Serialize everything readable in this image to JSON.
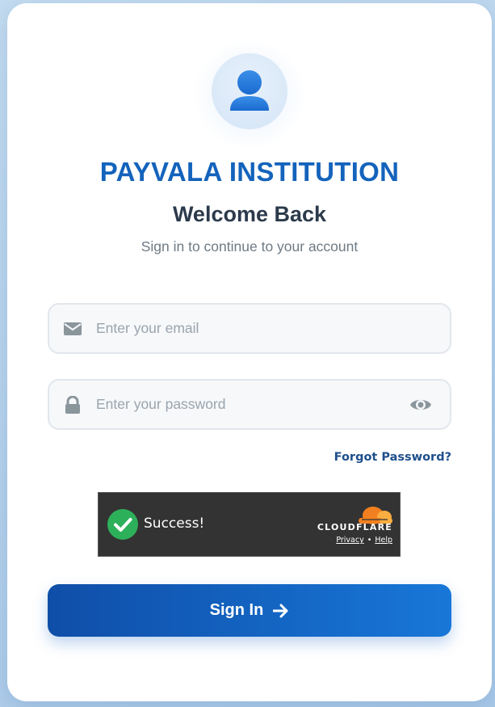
{
  "brand": {
    "name": "PAYVALA INSTITUTION",
    "color": "#1463bc"
  },
  "header": {
    "title": "Welcome Back",
    "subtitle": "Sign in to continue to your account"
  },
  "form": {
    "email": {
      "placeholder": "Enter your email",
      "value": "",
      "icon": "envelope-icon"
    },
    "password": {
      "placeholder": "Enter your password",
      "value": "",
      "icon": "lock-icon",
      "toggle_icon": "eye-icon"
    },
    "forgot_password_label": "Forgot Password?",
    "submit_label": "Sign In",
    "submit_icon": "arrow-right-icon"
  },
  "captcha": {
    "status": "Success!",
    "provider": "CLOUDFLARE",
    "privacy_label": "Privacy",
    "separator": "•",
    "help_label": "Help",
    "status_color": "#2db05a",
    "provider_color": "#f38020"
  },
  "colors": {
    "accent": "#1463bc",
    "button_start": "#0f4ea8",
    "button_end": "#1877d8"
  }
}
